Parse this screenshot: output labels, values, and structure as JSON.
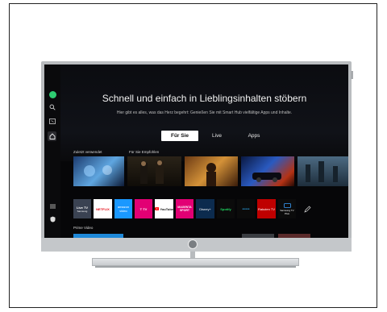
{
  "hero": {
    "headline": "Schnell und einfach in Lieblingsinhalten stöbern",
    "subline": "Hier gibt es alles, was das Herz begehrt: Genießen Sie mit Smart Hub vielfältige Apps und Inhalte."
  },
  "tabs": [
    {
      "label": "Für Sie",
      "active": true
    },
    {
      "label": "Live",
      "active": false
    },
    {
      "label": "Apps",
      "active": false
    }
  ],
  "sections": {
    "recent": "Zuletzt verwendet",
    "recommended": "Für Sie Empfohlen",
    "prime": "Prime Video"
  },
  "apps": [
    {
      "name": "Live TV",
      "sub": "Samsung"
    },
    {
      "name": "NETFLIX"
    },
    {
      "name": "amazon video"
    },
    {
      "name": "T TV"
    },
    {
      "name": "YouTube"
    },
    {
      "name": "MAGENTA SPORT"
    },
    {
      "name": "Disney+"
    },
    {
      "name": "Spotify"
    },
    {
      "name": "●●●●●"
    },
    {
      "name": "Rakuten TV"
    },
    {
      "name": "Samsung TV Plus"
    }
  ],
  "sidebar": {
    "icons": [
      "profile-icon",
      "search-icon",
      "media-icon",
      "home-icon",
      "menu-icon",
      "privacy-icon"
    ]
  },
  "colors": {
    "screen_bg": "#060608",
    "active_tab": "#ffffff",
    "prime_blue": "#1e88d8",
    "netflix_red": "#e50914",
    "magenta": "#e20074"
  }
}
